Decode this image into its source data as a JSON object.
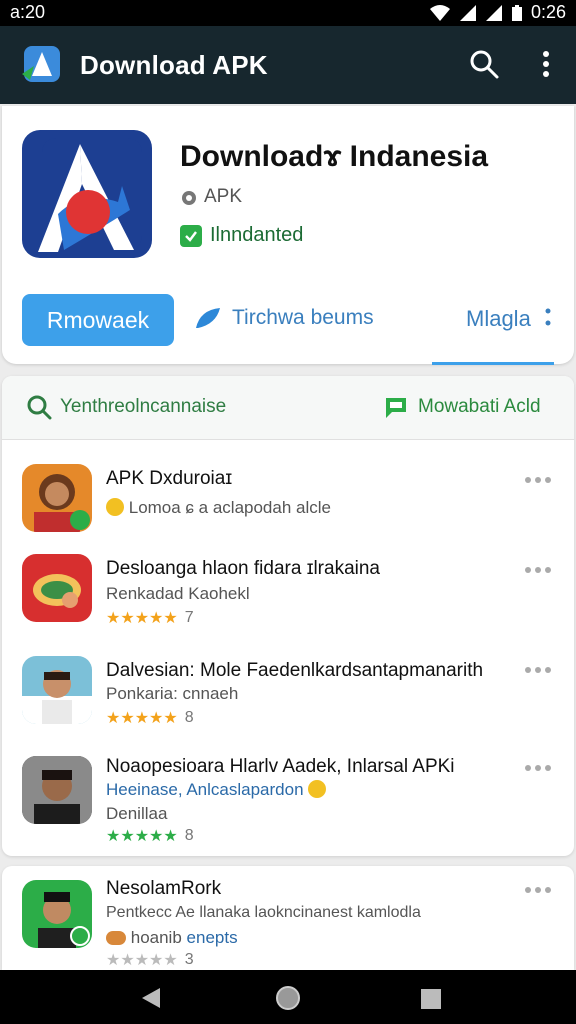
{
  "status": {
    "time": "a:20",
    "clock": "0:26"
  },
  "appbar": {
    "title": "Download APK",
    "icons": [
      "app-logo-icon",
      "search-icon",
      "more-vert-icon"
    ]
  },
  "app": {
    "name": "Downloadɤ Indanesia",
    "type": "APK",
    "status": "Ilnndanted",
    "primary_button": "Rmowaek",
    "secondary_tab": "Tirchwa beums",
    "tab_more": "Mlagla"
  },
  "filters": {
    "search_label": "Yenthreolncannaise",
    "chat_label": "Mowabati Acld"
  },
  "items": [
    {
      "title": "APK Dxduroiaɪ",
      "subtitle": "Lomoa ɕ a aclapodah alcle",
      "rating_count": ""
    },
    {
      "title": "Desloanga hlaon fidara ɪlrakaina",
      "subtitle": "Renkadad Kaohekl",
      "rating_count": "7"
    },
    {
      "title": "Dalvesian: Mole Faedenlkardsantapmanarith",
      "subtitle": "Ponkaria: cnnaeh",
      "rating_count": "8"
    },
    {
      "title": "Noaopesioara Hlarlv Aadek, Inlarsal APKi",
      "subtitle": "Heeinase, Anlcaslapardon",
      "subtitle2": "Denillaa",
      "rating_count": "8"
    }
  ],
  "card2": {
    "title": "NesolamRork",
    "subtitle": "Pentkecc Ae llanaka laokncinanest kamlodla",
    "tag_label": "hoanib",
    "tag_link": "enepts",
    "rating_count": "3"
  },
  "colors": {
    "appbar": "#17272e",
    "accent": "#3da0ea",
    "green": "#2cad48",
    "star": "#f3a21b"
  }
}
